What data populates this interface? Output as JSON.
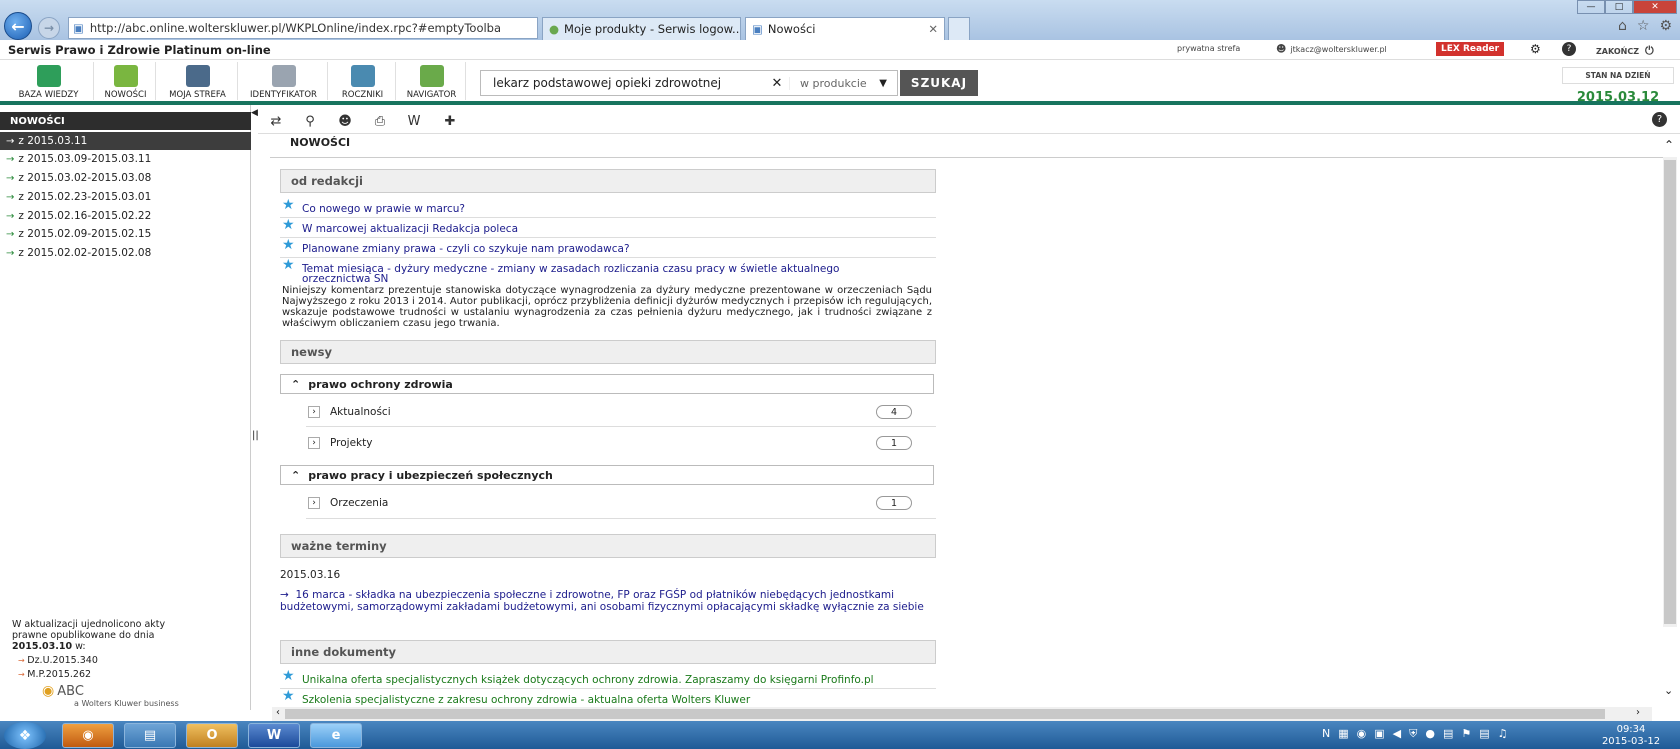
{
  "browser": {
    "url": "http://abc.online.wolterskluwer.pl/WKPLOnline/index.rpc?#emptyToolba",
    "tabs": [
      {
        "label": "Moje produkty - Serwis logow..."
      },
      {
        "label": "Nowości"
      }
    ]
  },
  "app": {
    "title": "Serwis Prawo i Zdrowie Platinum on-line",
    "top_links": {
      "private": "prywatna strefa",
      "user": "jtkacz@wolterskluwer.pl",
      "lex": "LEX Reader",
      "logout": "ZAKOŃCZ"
    }
  },
  "toolbar": {
    "items": [
      {
        "label": "BAZA WIEDZY",
        "color": "#2e9e5a"
      },
      {
        "label": "NOWOŚCI",
        "color": "#7ab640"
      },
      {
        "label": "MOJA STREFA",
        "color": "#4b6a8a"
      },
      {
        "label": "IDENTYFIKATOR",
        "color": "#9aa4b0"
      },
      {
        "label": "ROCZNIKI",
        "color": "#4a8ab0"
      },
      {
        "label": "NAVIGATOR",
        "color": "#6aaa4a"
      }
    ],
    "search_value": "lekarz podstawowej opieki zdrowotnej",
    "scope": "w produkcie",
    "search_button": "SZUKAJ",
    "stan_label": "STAN NA DZIEŃ",
    "stan_date": "2015.03.12"
  },
  "sidebar": {
    "header": "NOWOŚCI",
    "items": [
      {
        "label": "z 2015.03.11",
        "selected": true
      },
      {
        "label": "z 2015.03.09-2015.03.11"
      },
      {
        "label": "z 2015.03.02-2015.03.08"
      },
      {
        "label": "z 2015.02.23-2015.03.01"
      },
      {
        "label": "z 2015.02.16-2015.02.22"
      },
      {
        "label": "z 2015.02.09-2015.02.15"
      },
      {
        "label": "z 2015.02.02-2015.02.08"
      }
    ],
    "footer": {
      "line1": "W aktualizacji ujednolicono akty",
      "line2": "prawne opublikowane do dnia",
      "date": "2015.03.10",
      "w": " w:",
      "refs": [
        "Dz.U.2015.340",
        "M.P.2015.262"
      ],
      "logo": "ABC",
      "logo_sub": "a Wolters Kluwer business"
    }
  },
  "main": {
    "title": "NOWOŚCI",
    "od_redakcji": {
      "heading": "od redakcji",
      "links": [
        "Co nowego w prawie w marcu?",
        "W marcowej aktualizacji Redakcja poleca",
        "Planowane zmiany prawa - czyli co szykuje nam prawodawca?",
        "Temat miesiąca - dyżury medyczne - zmiany w zasadach rozliczania czasu pracy w świetle aktualnego",
        "orzecznictwa SN"
      ],
      "description": "Niniejszy komentarz prezentuje stanowiska dotyczące wynagrodzenia za dyżury medyczne prezentowane w orzeczeniach Sądu Najwyższego z roku 2013 i 2014. Autor publikacji, oprócz przybliżenia definicji dyżurów medycznych i przepisów ich regulujących, wskazuje podstawowe trudności w ustalaniu wynagrodzenia za czas pełnienia dyżuru medycznego, jak i trudności związane z właściwym obliczaniem czasu jego trwania."
    },
    "newsy": {
      "heading": "newsy",
      "groups": [
        {
          "title": "prawo ochrony zdrowia",
          "items": [
            {
              "label": "Aktualności",
              "count": "4"
            },
            {
              "label": "Projekty",
              "count": "1"
            }
          ]
        },
        {
          "title": "prawo pracy i ubezpieczeń społecznych",
          "items": [
            {
              "label": "Orzeczenia",
              "count": "1"
            }
          ]
        }
      ]
    },
    "terminy": {
      "heading": "ważne terminy",
      "date": "2015.03.16",
      "text": "16 marca - składka na ubezpieczenia społeczne i zdrowotne, FP oraz FGŚP od płatników niebędących jednostkami budżetowymi, samorządowymi zakładami budżetowymi, ani osobami fizycznymi opłacającymi składkę wyłącznie za siebie"
    },
    "inne": {
      "heading": "inne dokumenty",
      "links": [
        "Unikalna oferta specjalistycznych książek dotyczących ochrony zdrowia. Zapraszamy do księgarni Profinfo.pl",
        "Szkolenia specjalistyczne z zakresu ochrony zdrowia - aktualna oferta Wolters Kluwer"
      ]
    }
  },
  "taskbar": {
    "time": "09:34",
    "date": "2015-03-12"
  }
}
